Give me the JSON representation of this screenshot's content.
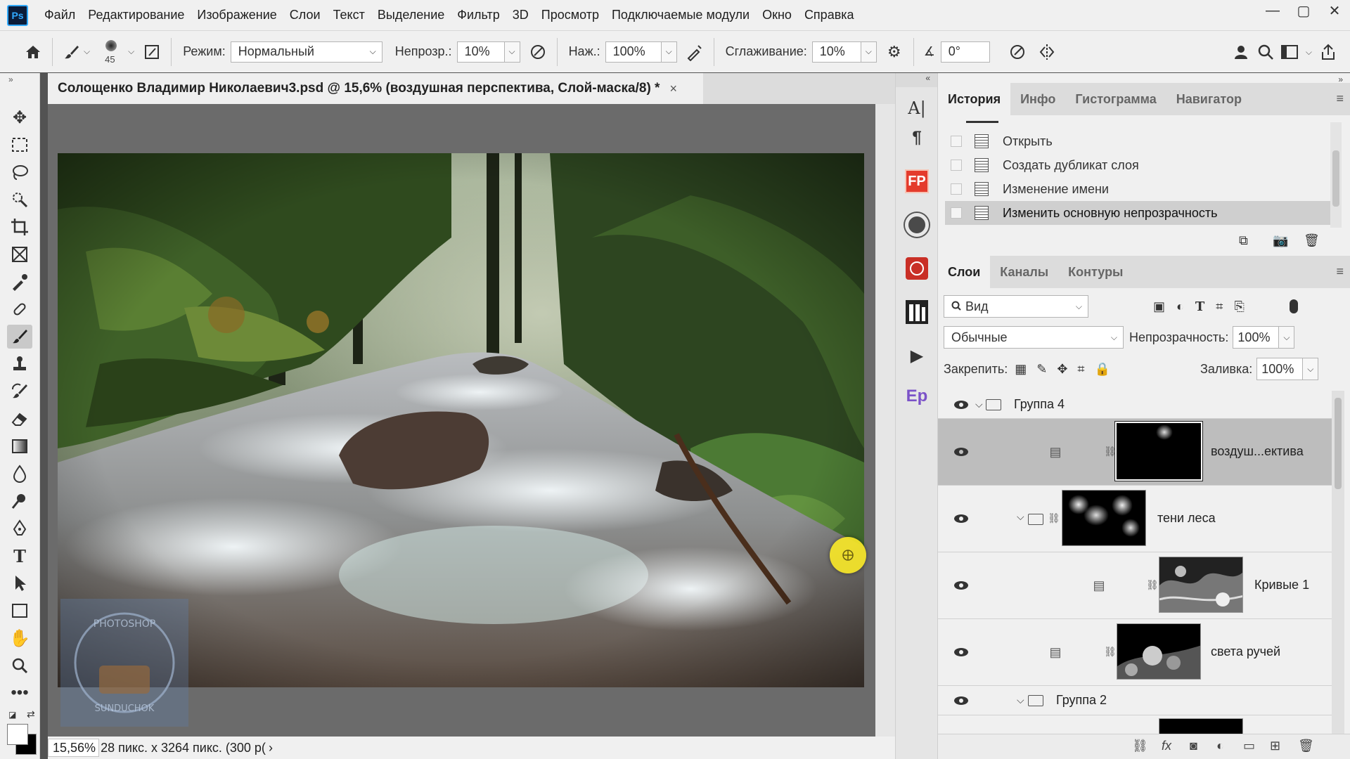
{
  "app": {
    "logo": "Ps"
  },
  "menu": [
    "Файл",
    "Редактирование",
    "Изображение",
    "Слои",
    "Текст",
    "Выделение",
    "Фильтр",
    "3D",
    "Просмотр",
    "Подключаемые модули",
    "Окно",
    "Справка"
  ],
  "window_controls": {
    "minimize": "—",
    "maximize": "▢",
    "close": "✕"
  },
  "options": {
    "brush_size": "45",
    "mode_label": "Режим:",
    "mode_value": "Нормальный",
    "opacity_label": "Непрозр.:",
    "opacity_value": "10%",
    "pressure_label": "Наж.:",
    "pressure_value": "100%",
    "smoothing_label": "Сглаживание:",
    "smoothing_value": "10%",
    "angle_value": "0°"
  },
  "document": {
    "tab_title": "Солощенко Владимир Николаевич3.psd @ 15,6% (воздушная перспектива, Слой-маска/8) *",
    "close": "×",
    "zoom": "15,56%",
    "info": "28 пикс. x 3264 пикс. (300 р(",
    "info_arrow": "›",
    "watermark_text": "PHOTOSHOP SUNDUCHOK"
  },
  "mini_panel": {
    "fp_label": "FP",
    "ep_label": "Ep",
    "collapse": "«"
  },
  "history": {
    "tabs": [
      "История",
      "Инфо",
      "Гистограмма",
      "Навигатор"
    ],
    "items": [
      "Открыть",
      "Создать дубликат слоя",
      "Изменение имени",
      "Изменить основную непрозрачность"
    ],
    "active_index": 3
  },
  "layers": {
    "tabs": [
      "Слои",
      "Каналы",
      "Контуры"
    ],
    "filter_value": "Вид",
    "blend_mode": "Обычные",
    "opacity_label": "Непрозрачность:",
    "opacity_value": "100%",
    "lock_label": "Закрепить:",
    "fill_label": "Заливка:",
    "fill_value": "100%",
    "rows": {
      "group4": "Группа 4",
      "air_persp": "воздуш...ектива",
      "forest_shadows": "тени леса",
      "curves1": "Кривые 1",
      "stream_lights": "света ручей",
      "group2": "Группа 2"
    }
  },
  "colors": {
    "panel_bg": "#f0f0f0",
    "canvas_bg": "#6b6b6b",
    "selected_row": "#bdbdbd",
    "cursor": "#f6e628"
  }
}
